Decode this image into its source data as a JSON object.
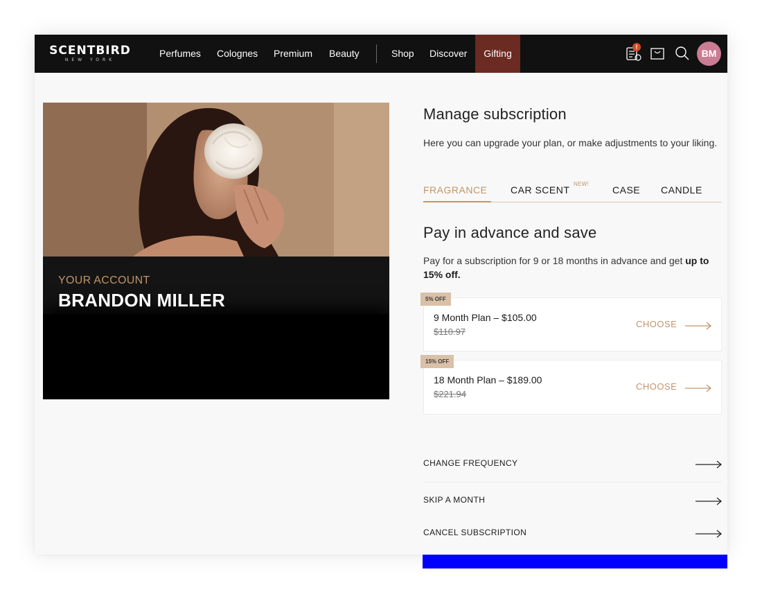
{
  "brand": {
    "name": "SCENTBIRD",
    "sub": "NEW YORK"
  },
  "nav": {
    "items": [
      "Perfumes",
      "Colognes",
      "Premium",
      "Beauty",
      "Shop",
      "Discover",
      "Gifting"
    ]
  },
  "header": {
    "notification_badge": "!",
    "avatar_initials": "BM"
  },
  "hero": {
    "account_label": "YOUR ACCOUNT",
    "name": "BRANDON MILLER"
  },
  "manage": {
    "title": "Manage subscription",
    "description": "Here you can upgrade your plan, or make adjustments to your liking.",
    "tabs": [
      {
        "label": "FRAGRANCE",
        "active": true
      },
      {
        "label": "CAR SCENT",
        "badge": "NEW!"
      },
      {
        "label": "CASE"
      },
      {
        "label": "CANDLE"
      }
    ]
  },
  "advance": {
    "title": "Pay in advance and save",
    "description": "Pay for a subscription for 9 or 18 months in advance and get ",
    "description_bold": "up to 15% off.",
    "plans": [
      {
        "tag": "5% OFF",
        "name": "9 Month Plan – $105.00",
        "old_price": "$110.97",
        "cta": "CHOOSE"
      },
      {
        "tag": "15% OFF",
        "name": "18 Month Plan – $189.00",
        "old_price": "$221.94",
        "cta": "CHOOSE"
      }
    ]
  },
  "actions": [
    {
      "label": "CHANGE FREQUENCY"
    },
    {
      "label": "SKIP A MONTH"
    },
    {
      "label": "CANCEL SUBSCRIPTION"
    }
  ],
  "colors": {
    "accent": "#c39468",
    "header_bg": "#111111",
    "gifting_bg": "#6b2a22",
    "avatar_bg": "#c97c92",
    "blue_bar": "#0000ff"
  }
}
